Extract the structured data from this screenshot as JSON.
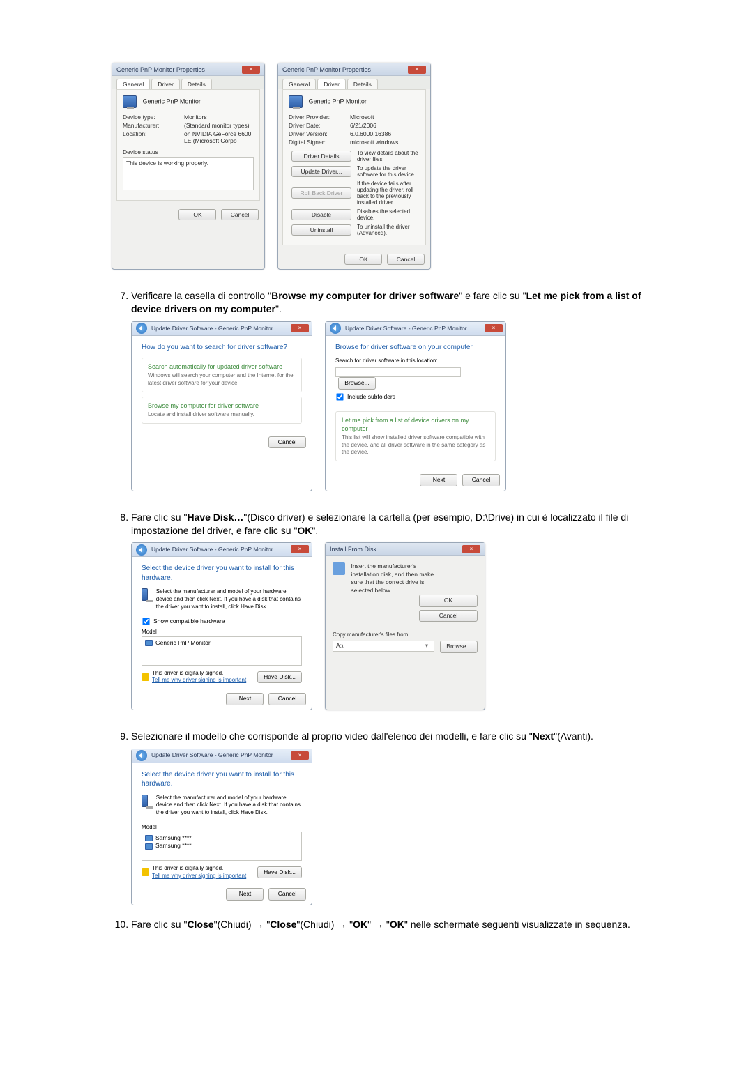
{
  "props_general": {
    "title": "Generic PnP Monitor Properties",
    "tabs": {
      "general": "General",
      "driver": "Driver",
      "details": "Details"
    },
    "device_name": "Generic PnP Monitor",
    "devtype_k": "Device type:",
    "devtype_v": "Monitors",
    "mfg_k": "Manufacturer:",
    "mfg_v": "(Standard monitor types)",
    "loc_k": "Location:",
    "loc_v": "on NVIDIA GeForce 6600 LE (Microsoft Corpo",
    "status_lbl": "Device status",
    "status_txt": "This device is working properly.",
    "ok": "OK",
    "cancel": "Cancel"
  },
  "props_driver": {
    "prov_k": "Driver Provider:",
    "prov_v": "Microsoft",
    "date_k": "Driver Date:",
    "date_v": "6/21/2006",
    "ver_k": "Driver Version:",
    "ver_v": "6.0.6000.16386",
    "signer_k": "Digital Signer:",
    "signer_v": "microsoft windows",
    "b_details": "Driver Details",
    "b_details_d": "To view details about the driver files.",
    "b_update": "Update Driver...",
    "b_update_d": "To update the driver software for this device.",
    "b_roll": "Roll Back Driver",
    "b_roll_d": "If the device fails after updating the driver, roll back to the previously installed driver.",
    "b_disable": "Disable",
    "b_disable_d": "Disables the selected device.",
    "b_uninst": "Uninstall",
    "b_uninst_d": "To uninstall the driver (Advanced)."
  },
  "step7": {
    "text_a": "Verificare la casella di controllo \"",
    "bold_a": "Browse my computer for driver software",
    "text_b": "\" e fare clic su \"",
    "bold_b": "Let me pick from a list of device drivers on my computer",
    "text_c": "\".",
    "wiz_crumb": "Update Driver Software - Generic PnP Monitor",
    "left_h": "How do you want to search for driver software?",
    "left_o1_t": "Search automatically for updated driver software",
    "left_o1_s": "Windows will search your computer and the Internet for the latest driver software for your device.",
    "left_o2_t": "Browse my computer for driver software",
    "left_o2_s": "Locate and install driver software manually.",
    "right_h": "Browse for driver software on your computer",
    "right_lbl": "Search for driver software in this location:",
    "right_browse": "Browse...",
    "right_chk": "Include subfolders",
    "right_o_t": "Let me pick from a list of device drivers on my computer",
    "right_o_s": "This list will show installed driver software compatible with the device, and all driver software in the same category as the device.",
    "next": "Next",
    "cancel": "Cancel"
  },
  "step8": {
    "text_a": "Fare clic su \"",
    "bold_a": "Have Disk…",
    "text_b": "\"(Disco driver) e selezionare la cartella (per esempio, D:\\Drive) in cui è localizzato il file di impostazione del driver, e fare clic su \"",
    "bold_b": "OK",
    "text_c": "\".",
    "left_h": "Select the device driver you want to install for this hardware.",
    "left_desc": "Select the manufacturer and model of your hardware device and then click Next. If you have a disk that contains the driver you want to install, click Have Disk.",
    "left_chk": "Show compatible hardware",
    "model_hdr": "Model",
    "model_item": "Generic PnP Monitor",
    "signed_txt": "This driver is digitally signed.",
    "signed_link": "Tell me why driver signing is important",
    "have_disk": "Have Disk...",
    "next": "Next",
    "cancel": "Cancel",
    "ifd_title": "Install From Disk",
    "ifd_msg": "Insert the manufacturer's installation disk, and then make sure that the correct drive is selected below.",
    "ifd_ok": "OK",
    "ifd_cancel": "Cancel",
    "ifd_copy_lbl": "Copy manufacturer's files from:",
    "ifd_sel": "A:\\",
    "ifd_browse": "Browse..."
  },
  "step9": {
    "text_a": "Selezionare il modello che corrisponde al proprio video dall'elenco dei modelli, e fare clic su \"",
    "bold_a": "Next",
    "text_b": "\"(Avanti).",
    "h": "Select the device driver you want to install for this hardware.",
    "desc": "Select the manufacturer and model of your hardware device and then click Next. If you have a disk that contains the driver you want to install, click Have Disk.",
    "model_hdr": "Model",
    "item1": "Samsung ****",
    "item2": "Samsung ****",
    "signed_txt": "This driver is digitally signed.",
    "signed_link": "Tell me why driver signing is important",
    "have_disk": "Have Disk...",
    "next": "Next",
    "cancel": "Cancel"
  },
  "step10": {
    "text_a": "Fare clic su \"",
    "bold_a": "Close",
    "text_b": "\"(Chiudi) → \"",
    "bold_b": "Close",
    "text_c": "\"(Chiudi) → \"",
    "bold_c": "OK",
    "text_d": "\" → \"",
    "bold_d": "OK",
    "text_e": "\" nelle schermate seguenti visualizzate in sequenza."
  }
}
